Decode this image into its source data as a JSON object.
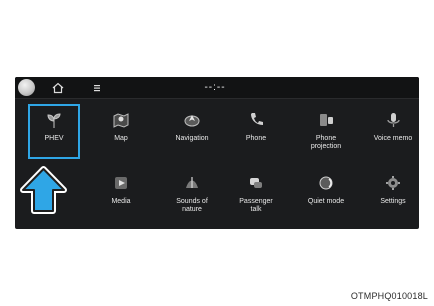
{
  "status_bar": {
    "clock": "--:--",
    "icons": [
      "avatar",
      "home-icon",
      "menu-icon"
    ]
  },
  "apps": [
    {
      "id": "phev",
      "label": "PHEV",
      "icon": "plant-icon"
    },
    {
      "id": "map",
      "label": "Map",
      "icon": "map-icon"
    },
    {
      "id": "navigation",
      "label": "Navigation",
      "icon": "navigation-icon"
    },
    {
      "id": "phone",
      "label": "Phone",
      "icon": "phone-icon"
    },
    {
      "id": "phone-projection",
      "label": "Phone\nprojection",
      "icon": "phone-projection-icon"
    },
    {
      "id": "voice-memo",
      "label": "Voice memo",
      "icon": "voice-memo-icon"
    },
    {
      "id": "media",
      "label": "Media",
      "icon": "media-icon"
    },
    {
      "id": "sounds-of-nature",
      "label": "Sounds of\nnature",
      "icon": "sounds-of-nature-icon"
    },
    {
      "id": "passenger-talk",
      "label": "Passenger\ntalk",
      "icon": "passenger-talk-icon"
    },
    {
      "id": "quiet-mode",
      "label": "Quiet mode",
      "icon": "quiet-mode-icon"
    },
    {
      "id": "settings",
      "label": "Settings",
      "icon": "settings-icon"
    }
  ],
  "selected_app": "phev",
  "pointer": {
    "icon": "up-arrow-icon",
    "target": "phev"
  },
  "figure_code": "OTMPHQ010018L",
  "colors": {
    "highlight": "#2fa6e6",
    "screen_bg": "#1b1c1e",
    "arrow_fill": "#2fa6e6"
  }
}
